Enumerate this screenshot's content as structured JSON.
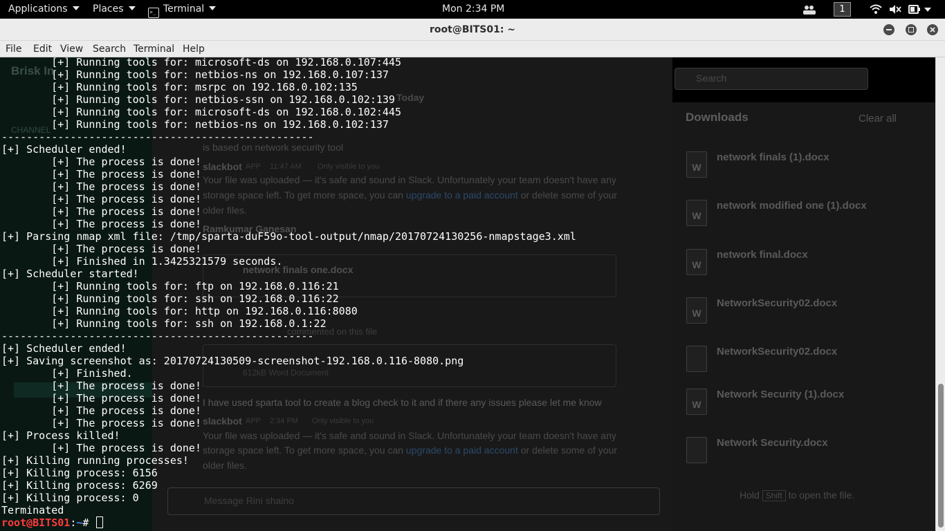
{
  "topbar": {
    "applications": "Applications",
    "places": "Places",
    "terminal": "Terminal",
    "clock": "Mon  2:34 PM",
    "workspace": "1"
  },
  "window": {
    "title": "root@BITS01: ~"
  },
  "menu": [
    "File",
    "Edit",
    "View",
    "Search",
    "Terminal",
    "Help"
  ],
  "terminal": {
    "lines": [
      "        [+] Running tools for: microsoft-ds on 192.168.0.107:445",
      "        [+] Running tools for: netbios-ns on 192.168.0.107:137",
      "        [+] Running tools for: msrpc on 192.168.0.102:135",
      "        [+] Running tools for: netbios-ssn on 192.168.0.102:139",
      "        [+] Running tools for: microsoft-ds on 192.168.0.102:445",
      "        [+] Running tools for: netbios-ns on 192.168.0.102:137",
      "--------------------------------------------------",
      "[+] Scheduler ended!",
      "        [+] The process is done!",
      "        [+] The process is done!",
      "        [+] The process is done!",
      "        [+] The process is done!",
      "        [+] The process is done!",
      "        [+] The process is done!",
      "[+] Parsing nmap xml file: /tmp/sparta-duF59o-tool-output/nmap/20170724130256-nmapstage3.xml",
      "        [+] The process is done!",
      "        [+] Finished in 1.3425321579 seconds.",
      "[+] Scheduler started!",
      "        [+] Running tools for: ftp on 192.168.0.116:21",
      "        [+] Running tools for: ssh on 192.168.0.116:22",
      "        [+] Running tools for: http on 192.168.0.116:8080",
      "        [+] Running tools for: ssh on 192.168.0.1:22",
      "--------------------------------------------------",
      "[+] Scheduler ended!",
      "[+] Saving screenshot as: 20170724130509-screenshot-192.168.0.116-8080.png",
      "        [+] Finished.",
      "        [+] The process is done!",
      "        [+] The process is done!",
      "        [+] The process is done!",
      "        [+] The process is done!",
      "[+] Process killed!",
      "        [+] The process is done!",
      "[+] Killing running processes!",
      "[+] Killing process: 6156",
      "[+] Killing process: 6269",
      "[+] Killing process: 0",
      "Terminated"
    ],
    "prompt_user": "root@BITS01",
    "prompt_path": "~",
    "prompt_symbol": "# "
  },
  "background_slack": {
    "workspace": "Brisk In",
    "channels_heading": "CHANNEL",
    "search_placeholder": "Search",
    "today": "Today",
    "downloads_title": "Downloads",
    "clear_all": "Clear all",
    "downloads": [
      "network finals (1).docx",
      "network modified one (1).docx",
      "network final.docx",
      "NetworkSecurity02.docx",
      "NetworkSecurity02.docx",
      "Network Security (1).docx",
      "Network Security.docx"
    ],
    "hold_shift": "Hold",
    "shift_key": "Shift",
    "open_file": "to open the file.",
    "msg_blog": "is based on network security tool",
    "sender_slackbot": "slackbot",
    "app_tag": "APP",
    "time_1": "11:47 AM",
    "time_2": "2:34 PM",
    "only_visible": "Only visible to you",
    "upload_msg_1": "Your file was uploaded — it's safe and sound in Slack. Unfortunately your team doesn't have any",
    "upload_msg_2a": "storage space left. To get more space, you can",
    "upload_link": "upgrade to a paid account",
    "upload_msg_2b": "or delete some of your",
    "upload_msg_3": "older files.",
    "sender_ramkumar": "Ramkumar Ganesan",
    "attachment_name": "network finals one.docx",
    "attachment_size": "612kB Word Document",
    "commented": "commented on this file",
    "sparta_msg": "I have used sparta tool to create a blog check to it and if there any issues please let me know",
    "message_placeholder": "Message Rini shaino"
  },
  "colors": {
    "prompt_user": "#ff3b3b",
    "prompt_path": "#4c8cff",
    "terminal_bg": "#000000",
    "terminal_fg": "#ffffff"
  }
}
